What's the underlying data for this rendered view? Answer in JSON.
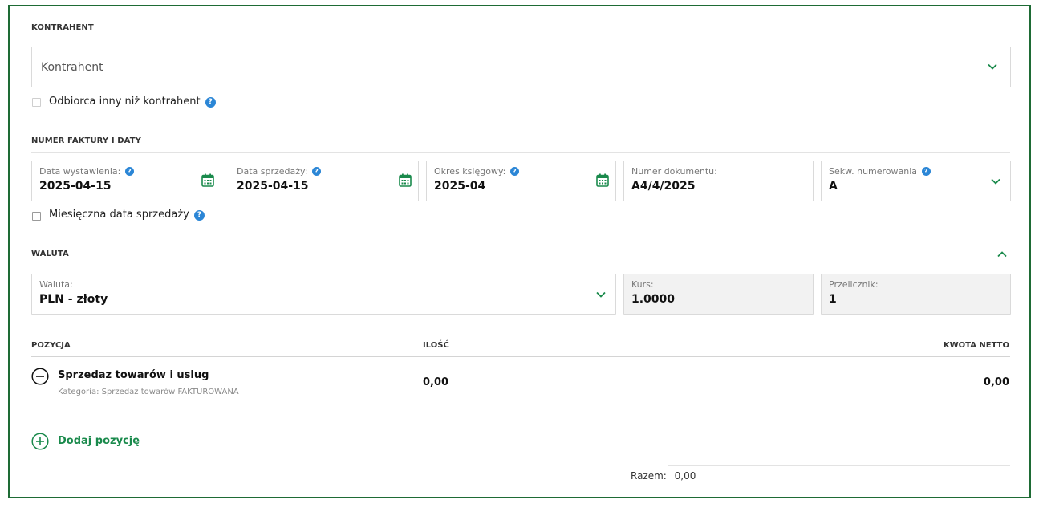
{
  "contractor": {
    "section_title": "KONTRAHENT",
    "select_placeholder": "Kontrahent",
    "other_recipient_label": "Odbiorca inny niż kontrahent"
  },
  "invoice": {
    "section_title": "NUMER FAKTURY I DATY",
    "issue_date": {
      "label": "Data wystawienia:",
      "value": "2025-04-15"
    },
    "sale_date": {
      "label": "Data sprzedaży:",
      "value": "2025-04-15"
    },
    "accounting_period": {
      "label": "Okres księgowy:",
      "value": "2025-04"
    },
    "document_number": {
      "label": "Numer dokumentu:",
      "value": "A4/4/2025"
    },
    "numbering_sequence": {
      "label": "Sekw. numerowania",
      "value": "A"
    },
    "monthly_sale_date_label": "Miesięczna data sprzedaży"
  },
  "currency": {
    "section_title": "WALUTA",
    "currency_field": {
      "label": "Waluta:",
      "value": "PLN - złoty"
    },
    "rate_field": {
      "label": "Kurs:",
      "value": "1.0000"
    },
    "converter_field": {
      "label": "Przelicznik:",
      "value": "1"
    }
  },
  "positions": {
    "headers": {
      "position": "POZYCJA",
      "quantity": "ILOŚĆ",
      "net_amount": "KWOTA NETTO"
    },
    "items": [
      {
        "name": "Sprzedaz towarów i uslug",
        "category": "Kategoria: Sprzedaz towarów FAKTUROWANA",
        "quantity": "0,00",
        "net_amount": "0,00"
      }
    ],
    "add_label": "Dodaj pozycję",
    "total_label": "Razem:",
    "total_value": "0,00"
  },
  "icons": {
    "help": "question-circle-icon",
    "calendar": "calendar-icon",
    "chevron_down": "chevron-down-icon",
    "chevron_up": "chevron-up-icon",
    "remove": "minus-circle-icon",
    "add": "plus-circle-icon"
  },
  "colors": {
    "frame_border": "#1e6b35",
    "accent_green": "#1a8a4c",
    "help_blue": "#2b86d6",
    "disabled_bg": "#f2f2f2"
  }
}
